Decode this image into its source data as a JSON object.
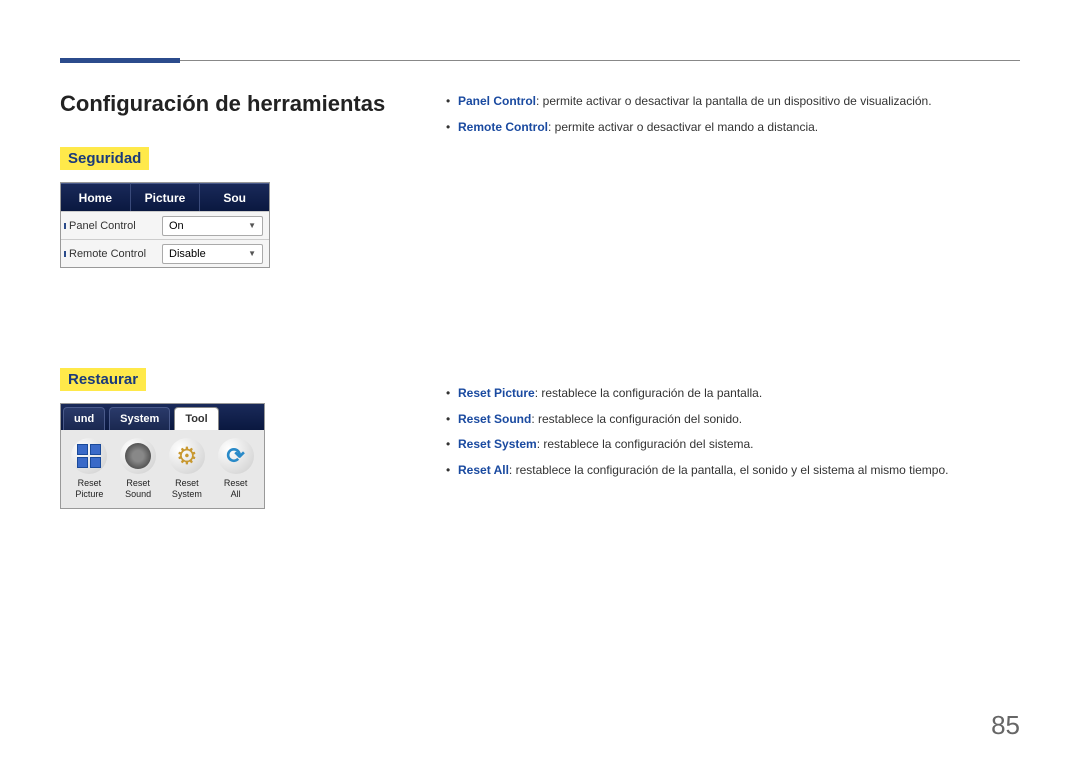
{
  "page": {
    "title": "Configuración de herramientas",
    "number": "85"
  },
  "sections": {
    "security": {
      "label": "Seguridad",
      "widget": {
        "tabs": [
          "Home",
          "Picture",
          "Sou"
        ],
        "rows": [
          {
            "label": "Panel Control",
            "value": "On"
          },
          {
            "label": "Remote Control",
            "value": "Disable"
          }
        ]
      },
      "bullets": [
        {
          "term": "Panel Control",
          "text": ": permite activar o desactivar la pantalla de un dispositivo de visualización."
        },
        {
          "term": "Remote Control",
          "text": ": permite activar o desactivar el mando a distancia."
        }
      ]
    },
    "reset": {
      "label": "Restaurar",
      "widget": {
        "tabs": [
          {
            "label": "und",
            "active": false
          },
          {
            "label": "System",
            "active": false
          },
          {
            "label": "Tool",
            "active": true
          }
        ],
        "items": [
          {
            "icon": "grid-icon",
            "label": "Reset Picture"
          },
          {
            "icon": "speaker-icon",
            "label": "Reset Sound"
          },
          {
            "icon": "gear-icon",
            "label": "Reset System"
          },
          {
            "icon": "refresh-icon",
            "label": "Reset All"
          }
        ]
      },
      "bullets": [
        {
          "term": "Reset Picture",
          "text": ": restablece la configuración de la pantalla."
        },
        {
          "term": "Reset Sound",
          "text": ": restablece la configuración del sonido."
        },
        {
          "term": "Reset System",
          "text": ": restablece la configuración del sistema."
        },
        {
          "term": "Reset All",
          "text": ": restablece la configuración de la pantalla, el sonido y el sistema al mismo tiempo."
        }
      ]
    }
  }
}
